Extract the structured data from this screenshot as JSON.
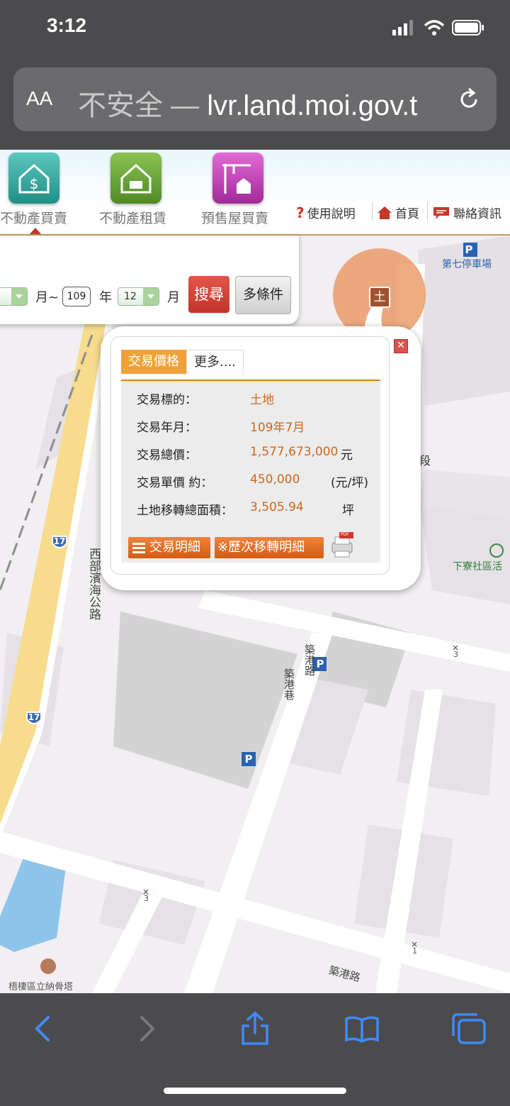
{
  "status_bar": {
    "time": "3:12"
  },
  "browser": {
    "text_size_label": "AA",
    "url_prefix": "不安全 — ",
    "url": "lvr.land.moi.gov.t",
    "back_icon": "chevron-left-icon",
    "forward_icon": "chevron-right-icon",
    "share_icon": "share-icon",
    "bookmarks_icon": "book-icon",
    "tabs_icon": "tabs-icon"
  },
  "site_nav": {
    "items": [
      {
        "label": "不動產買賣",
        "color": "#2fa39a"
      },
      {
        "label": "不動產租賃",
        "color": "#6b9e3a"
      },
      {
        "label": "預售屋買賣",
        "color": "#c23db5"
      }
    ],
    "links": [
      {
        "label": "使用說明"
      },
      {
        "label": "首頁"
      },
      {
        "label": "聯絡資訊"
      }
    ]
  },
  "search": {
    "month_label": "月~",
    "year_value": "109",
    "year_label": "年",
    "month_value": "12",
    "month_end_label": "月",
    "search_button": "搜尋",
    "advanced_button": "多條件"
  },
  "marker": {
    "label": "土"
  },
  "popup": {
    "tabs": [
      "交易價格",
      "更多...."
    ],
    "rows": [
      {
        "label": "交易標的：",
        "value": "土地",
        "unit": ""
      },
      {
        "label": "交易年月：",
        "value": "109年7月",
        "unit": ""
      },
      {
        "label": "交易總價：",
        "value": "1,577,673,000",
        "unit": "元"
      },
      {
        "label": "交易單價 約：",
        "value": "450,000",
        "unit": "(元/坪)"
      },
      {
        "label": "土地移轉總面積：",
        "value": "3,505.94",
        "unit": "坪"
      }
    ],
    "detail_button": "交易明細",
    "history_button": "※歷次移轉明細",
    "pdf_label": "PDF"
  },
  "map_labels": {
    "parking_lot": "第七停車場",
    "road_section": "段",
    "community": "下寮社區活",
    "highway_1": "西部濱海公路",
    "highway_prefix": "西",
    "road_17": "17",
    "alley_1": "築港路",
    "alley_2": "築港巷",
    "road_bottom": "築港路",
    "landmark": "梧棲區立納骨塔",
    "num_3a": "3",
    "num_1": "1",
    "num_3b": "3",
    "parking": "P"
  }
}
